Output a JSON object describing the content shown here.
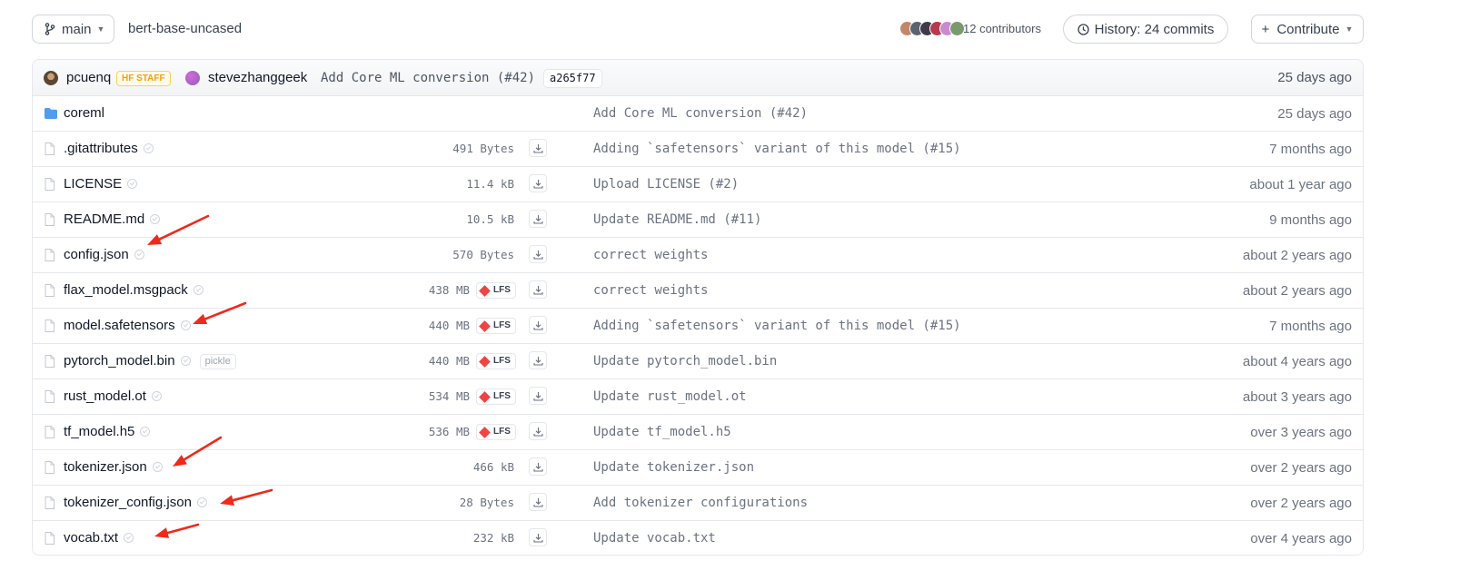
{
  "branch": {
    "label": "main"
  },
  "repo_path": "bert-base-uncased",
  "contributors": {
    "label": "12 contributors",
    "avatar_colors": [
      "#c0876b",
      "#5b6270",
      "#3f3a4a",
      "#b63a4f",
      "#c98bd0",
      "#7a9a6e"
    ]
  },
  "history": {
    "label": "History: 24 commits"
  },
  "contribute": {
    "label": "Contribute"
  },
  "last_commit": {
    "author1": "pcuenq",
    "author1_badge": "HF STAFF",
    "author2": "stevezhanggeek",
    "message": "Add Core ML conversion (#42)",
    "sha": "a265f77",
    "time": "25 days ago"
  },
  "files": [
    {
      "name": "coreml",
      "type": "folder",
      "size": "",
      "lfs": false,
      "pickle": false,
      "message": "Add Core ML conversion (#42)",
      "time": "25 days ago"
    },
    {
      "name": ".gitattributes",
      "type": "file",
      "size": "491 Bytes",
      "lfs": false,
      "pickle": false,
      "message": "Adding `safetensors` variant of this model (#15)",
      "time": "7 months ago"
    },
    {
      "name": "LICENSE",
      "type": "file",
      "size": "11.4 kB",
      "lfs": false,
      "pickle": false,
      "message": "Upload LICENSE (#2)",
      "time": "about 1 year ago"
    },
    {
      "name": "README.md",
      "type": "file",
      "size": "10.5 kB",
      "lfs": false,
      "pickle": false,
      "message": "Update README.md (#11)",
      "time": "9 months ago"
    },
    {
      "name": "config.json",
      "type": "file",
      "size": "570 Bytes",
      "lfs": false,
      "pickle": false,
      "message": "correct weights",
      "time": "about 2 years ago"
    },
    {
      "name": "flax_model.msgpack",
      "type": "file",
      "size": "438 MB",
      "lfs": true,
      "pickle": false,
      "message": "correct weights",
      "time": "about 2 years ago"
    },
    {
      "name": "model.safetensors",
      "type": "file",
      "size": "440 MB",
      "lfs": true,
      "pickle": false,
      "message": "Adding `safetensors` variant of this model (#15)",
      "time": "7 months ago"
    },
    {
      "name": "pytorch_model.bin",
      "type": "file",
      "size": "440 MB",
      "lfs": true,
      "pickle": true,
      "message": "Update pytorch_model.bin",
      "time": "about 4 years ago"
    },
    {
      "name": "rust_model.ot",
      "type": "file",
      "size": "534 MB",
      "lfs": true,
      "pickle": false,
      "message": "Update rust_model.ot",
      "time": "about 3 years ago"
    },
    {
      "name": "tf_model.h5",
      "type": "file",
      "size": "536 MB",
      "lfs": true,
      "pickle": false,
      "message": "Update tf_model.h5",
      "time": "over 3 years ago"
    },
    {
      "name": "tokenizer.json",
      "type": "file",
      "size": "466 kB",
      "lfs": false,
      "pickle": false,
      "message": "Update tokenizer.json",
      "time": "over 2 years ago"
    },
    {
      "name": "tokenizer_config.json",
      "type": "file",
      "size": "28 Bytes",
      "lfs": false,
      "pickle": false,
      "message": "Add tokenizer configurations",
      "time": "over 2 years ago"
    },
    {
      "name": "vocab.txt",
      "type": "file",
      "size": "232 kB",
      "lfs": false,
      "pickle": false,
      "message": "Update vocab.txt",
      "time": "over 4 years ago"
    }
  ],
  "labels": {
    "lfs": "LFS",
    "pickle": "pickle"
  },
  "annotation": {
    "arrow_color": "#ef2a1a"
  }
}
